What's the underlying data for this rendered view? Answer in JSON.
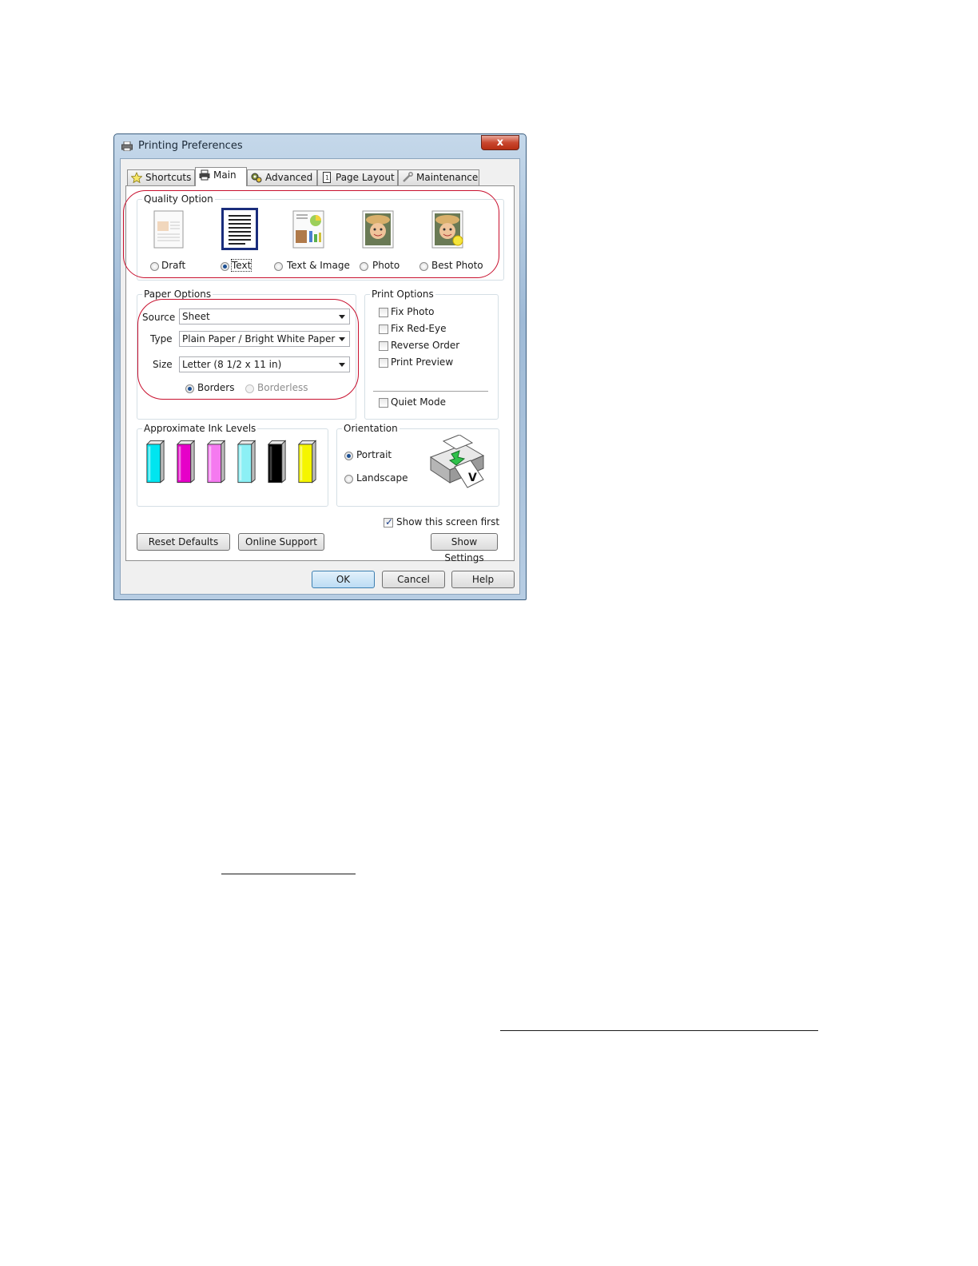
{
  "window": {
    "title": "Printing Preferences",
    "close_glyph": "x"
  },
  "tabs": [
    {
      "label": "Shortcuts",
      "icon": "star-icon"
    },
    {
      "label": "Main",
      "icon": "printer-icon",
      "active": true
    },
    {
      "label": "Advanced",
      "icon": "gears-icon"
    },
    {
      "label": "Page Layout",
      "icon": "page-icon"
    },
    {
      "label": "Maintenance",
      "icon": "wrench-icon"
    }
  ],
  "quality": {
    "title": "Quality Option",
    "selected": "Text",
    "options": [
      "Draft",
      "Text",
      "Text & Image",
      "Photo",
      "Best Photo"
    ]
  },
  "paper": {
    "title": "Paper Options",
    "source_label": "Source",
    "source_value": "Sheet",
    "type_label": "Type",
    "type_value": "Plain Paper / Bright White Paper",
    "size_label": "Size",
    "size_value": "Letter (8 1/2 x 11 in)",
    "borders_label": "Borders",
    "borderless_label": "Borderless",
    "borders_selected": true
  },
  "print_options": {
    "title": "Print Options",
    "items": [
      "Fix Photo",
      "Fix Red-Eye",
      "Reverse Order",
      "Print Preview"
    ],
    "quiet_mode": "Quiet Mode"
  },
  "ink": {
    "title": "Approximate Ink Levels",
    "cartridges": [
      {
        "color": "#00e5f0"
      },
      {
        "color": "#e600c8"
      },
      {
        "color": "#f57af0"
      },
      {
        "color": "#8cf0f5"
      },
      {
        "color": "#000000"
      },
      {
        "color": "#f5f500"
      }
    ]
  },
  "orientation": {
    "title": "Orientation",
    "portrait": "Portrait",
    "landscape": "Landscape",
    "selected": "Portrait"
  },
  "show_screen_first": {
    "label": "Show this screen first",
    "checked": true
  },
  "buttons": {
    "reset": "Reset Defaults",
    "online": "Online Support",
    "show_settings": "Show Settings",
    "ok": "OK",
    "cancel": "Cancel",
    "help": "Help"
  },
  "colors": {
    "highlight_ring": "#c8102e",
    "default_button": "#3c7fb1"
  }
}
